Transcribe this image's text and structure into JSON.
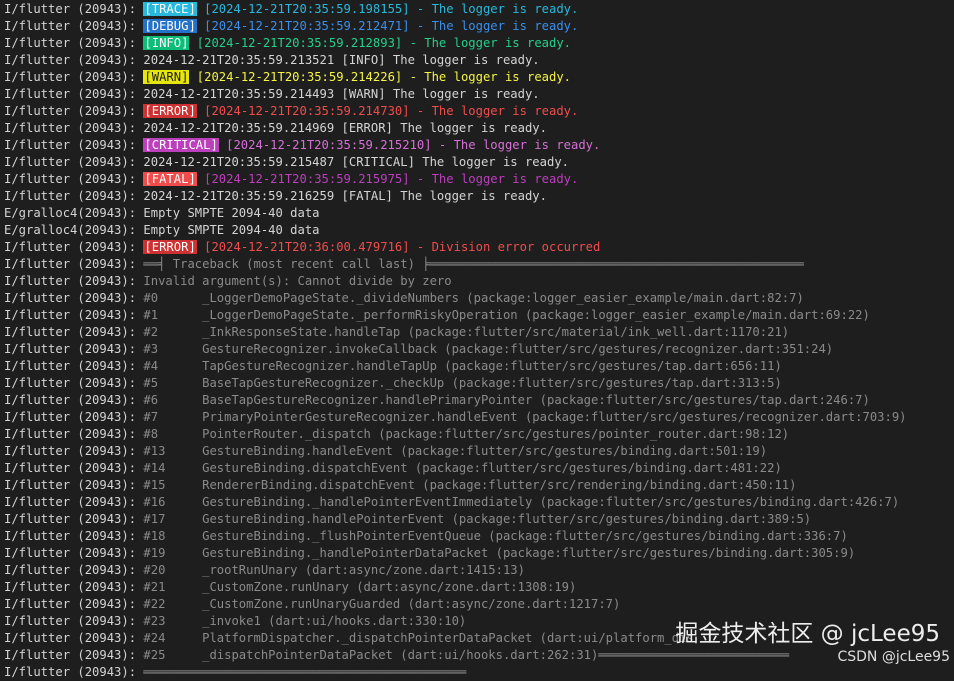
{
  "lines": [
    {
      "prefix": "I/flutter (20943): ",
      "tag": "TRACE",
      "tag_color": "#29b8db",
      "text": " [2024-12-21T20:35:59.198155] - The logger is ready.",
      "text_color": "#29b8db"
    },
    {
      "prefix": "I/flutter (20943): ",
      "tag": "DEBUG",
      "tag_color": "#2472c8",
      "text": " [2024-12-21T20:35:59.212471] - The logger is ready.",
      "text_color": "#3b8eea"
    },
    {
      "prefix": "I/flutter (20943): ",
      "tag": "INFO",
      "tag_color": "#0dbc79",
      "text": " [2024-12-21T20:35:59.212893] - The logger is ready.",
      "text_color": "#23d18b"
    },
    {
      "prefix": "I/flutter (20943): ",
      "tag": "",
      "tag_color": "",
      "text": "2024-12-21T20:35:59.213521 [INFO] The logger is ready.",
      "text_color": "#d4d4d4"
    },
    {
      "prefix": "I/flutter (20943): ",
      "tag": "WARN",
      "tag_color": "#e5e510",
      "text": " [2024-12-21T20:35:59.214226] - The logger is ready.",
      "text_color": "#f5f543"
    },
    {
      "prefix": "I/flutter (20943): ",
      "tag": "",
      "tag_color": "",
      "text": "2024-12-21T20:35:59.214493 [WARN] The logger is ready.",
      "text_color": "#d4d4d4"
    },
    {
      "prefix": "I/flutter (20943): ",
      "tag": "ERROR",
      "tag_color": "#cd3131",
      "text": " [2024-12-21T20:35:59.214730] - The logger is ready.",
      "text_color": "#f14c4c"
    },
    {
      "prefix": "I/flutter (20943): ",
      "tag": "",
      "tag_color": "",
      "text": "2024-12-21T20:35:59.214969 [ERROR] The logger is ready.",
      "text_color": "#d4d4d4"
    },
    {
      "prefix": "I/flutter (20943): ",
      "tag": "CRITICAL",
      "tag_color": "#bc3fbc",
      "text": " [2024-12-21T20:35:59.215210] - The logger is ready.",
      "text_color": "#d670d6"
    },
    {
      "prefix": "I/flutter (20943): ",
      "tag": "",
      "tag_color": "",
      "text": "2024-12-21T20:35:59.215487 [CRITICAL] The logger is ready.",
      "text_color": "#d4d4d4"
    },
    {
      "prefix": "I/flutter (20943): ",
      "tag": "FATAL",
      "tag_color": "#f14c4c",
      "text": " [2024-12-21T20:35:59.215975] - The logger is ready.",
      "text_color": "#bc3fbc"
    },
    {
      "prefix": "I/flutter (20943): ",
      "tag": "",
      "tag_color": "",
      "text": "2024-12-21T20:35:59.216259 [FATAL] The logger is ready.",
      "text_color": "#d4d4d4"
    },
    {
      "prefix": "E/gralloc4(20943): ",
      "tag": "",
      "tag_color": "",
      "text": "Empty SMPTE 2094-40 data",
      "text_color": "#d4d4d4"
    },
    {
      "prefix": "E/gralloc4(20943): ",
      "tag": "",
      "tag_color": "",
      "text": "Empty SMPTE 2094-40 data",
      "text_color": "#d4d4d4"
    },
    {
      "prefix": "I/flutter (20943): ",
      "tag": "ERROR",
      "tag_color": "#cd3131",
      "text": " [2024-12-21T20:36:00.479716] - Division error occurred",
      "text_color": "#f14c4c"
    },
    {
      "prefix": "I/flutter (20943): ",
      "tag": "",
      "tag_color": "",
      "text": "══╡ Traceback (most recent call last) ╞═══════════════════════════════════════════════════",
      "text_color": "#8a8a8a"
    },
    {
      "prefix": "I/flutter (20943): ",
      "tag": "",
      "tag_color": "",
      "text": "Invalid argument(s): Cannot divide by zero",
      "text_color": "#8a8a8a"
    },
    {
      "prefix": "I/flutter (20943): ",
      "tag": "",
      "tag_color": "",
      "text": "#0      _LoggerDemoPageState._divideNumbers (package:logger_easier_example/main.dart:82:7)",
      "text_color": "#8a8a8a"
    },
    {
      "prefix": "I/flutter (20943): ",
      "tag": "",
      "tag_color": "",
      "text": "#1      _LoggerDemoPageState._performRiskyOperation (package:logger_easier_example/main.dart:69:22)",
      "text_color": "#8a8a8a"
    },
    {
      "prefix": "I/flutter (20943): ",
      "tag": "",
      "tag_color": "",
      "text": "#2      _InkResponseState.handleTap (package:flutter/src/material/ink_well.dart:1170:21)",
      "text_color": "#8a8a8a"
    },
    {
      "prefix": "I/flutter (20943): ",
      "tag": "",
      "tag_color": "",
      "text": "#3      GestureRecognizer.invokeCallback (package:flutter/src/gestures/recognizer.dart:351:24)",
      "text_color": "#8a8a8a"
    },
    {
      "prefix": "I/flutter (20943): ",
      "tag": "",
      "tag_color": "",
      "text": "#4      TapGestureRecognizer.handleTapUp (package:flutter/src/gestures/tap.dart:656:11)",
      "text_color": "#8a8a8a"
    },
    {
      "prefix": "I/flutter (20943): ",
      "tag": "",
      "tag_color": "",
      "text": "#5      BaseTapGestureRecognizer._checkUp (package:flutter/src/gestures/tap.dart:313:5)",
      "text_color": "#8a8a8a"
    },
    {
      "prefix": "I/flutter (20943): ",
      "tag": "",
      "tag_color": "",
      "text": "#6      BaseTapGestureRecognizer.handlePrimaryPointer (package:flutter/src/gestures/tap.dart:246:7)",
      "text_color": "#8a8a8a"
    },
    {
      "prefix": "I/flutter (20943): ",
      "tag": "",
      "tag_color": "",
      "text": "#7      PrimaryPointerGestureRecognizer.handleEvent (package:flutter/src/gestures/recognizer.dart:703:9)",
      "text_color": "#8a8a8a"
    },
    {
      "prefix": "I/flutter (20943): ",
      "tag": "",
      "tag_color": "",
      "text": "#8      PointerRouter._dispatch (package:flutter/src/gestures/pointer_router.dart:98:12)",
      "text_color": "#8a8a8a"
    },
    {
      "prefix": "I/flutter (20943): ",
      "tag": "",
      "tag_color": "",
      "text": "#13     GestureBinding.handleEvent (package:flutter/src/gestures/binding.dart:501:19)",
      "text_color": "#8a8a8a"
    },
    {
      "prefix": "I/flutter (20943): ",
      "tag": "",
      "tag_color": "",
      "text": "#14     GestureBinding.dispatchEvent (package:flutter/src/gestures/binding.dart:481:22)",
      "text_color": "#8a8a8a"
    },
    {
      "prefix": "I/flutter (20943): ",
      "tag": "",
      "tag_color": "",
      "text": "#15     RendererBinding.dispatchEvent (package:flutter/src/rendering/binding.dart:450:11)",
      "text_color": "#8a8a8a"
    },
    {
      "prefix": "I/flutter (20943): ",
      "tag": "",
      "tag_color": "",
      "text": "#16     GestureBinding._handlePointerEventImmediately (package:flutter/src/gestures/binding.dart:426:7)",
      "text_color": "#8a8a8a"
    },
    {
      "prefix": "I/flutter (20943): ",
      "tag": "",
      "tag_color": "",
      "text": "#17     GestureBinding.handlePointerEvent (package:flutter/src/gestures/binding.dart:389:5)",
      "text_color": "#8a8a8a"
    },
    {
      "prefix": "I/flutter (20943): ",
      "tag": "",
      "tag_color": "",
      "text": "#18     GestureBinding._flushPointerEventQueue (package:flutter/src/gestures/binding.dart:336:7)",
      "text_color": "#8a8a8a"
    },
    {
      "prefix": "I/flutter (20943): ",
      "tag": "",
      "tag_color": "",
      "text": "#19     GestureBinding._handlePointerDataPacket (package:flutter/src/gestures/binding.dart:305:9)",
      "text_color": "#8a8a8a"
    },
    {
      "prefix": "I/flutter (20943): ",
      "tag": "",
      "tag_color": "",
      "text": "#20     _rootRunUnary (dart:async/zone.dart:1415:13)",
      "text_color": "#8a8a8a"
    },
    {
      "prefix": "I/flutter (20943): ",
      "tag": "",
      "tag_color": "",
      "text": "#21     _CustomZone.runUnary (dart:async/zone.dart:1308:19)",
      "text_color": "#8a8a8a"
    },
    {
      "prefix": "I/flutter (20943): ",
      "tag": "",
      "tag_color": "",
      "text": "#22     _CustomZone.runUnaryGuarded (dart:async/zone.dart:1217:7)",
      "text_color": "#8a8a8a"
    },
    {
      "prefix": "I/flutter (20943): ",
      "tag": "",
      "tag_color": "",
      "text": "#23     _invoke1 (dart:ui/hooks.dart:330:10)",
      "text_color": "#8a8a8a"
    },
    {
      "prefix": "I/flutter (20943): ",
      "tag": "",
      "tag_color": "",
      "text": "#24     PlatformDispatcher._dispatchPointerDataPacket (dart:ui/platform_dis",
      "text_color": "#8a8a8a"
    },
    {
      "prefix": "I/flutter (20943): ",
      "tag": "",
      "tag_color": "",
      "text": "#25     _dispatchPointerDataPacket (dart:ui/hooks.dart:262:31)══════════════════════════",
      "text_color": "#8a8a8a"
    },
    {
      "prefix": "I/flutter (20943): ",
      "tag": "",
      "tag_color": "",
      "text": "════════════════════════════════════════════",
      "text_color": "#8a8a8a"
    }
  ],
  "watermark": {
    "main": "掘金技术社区 @ jcLee95",
    "sub": "CSDN @jcLee95"
  }
}
